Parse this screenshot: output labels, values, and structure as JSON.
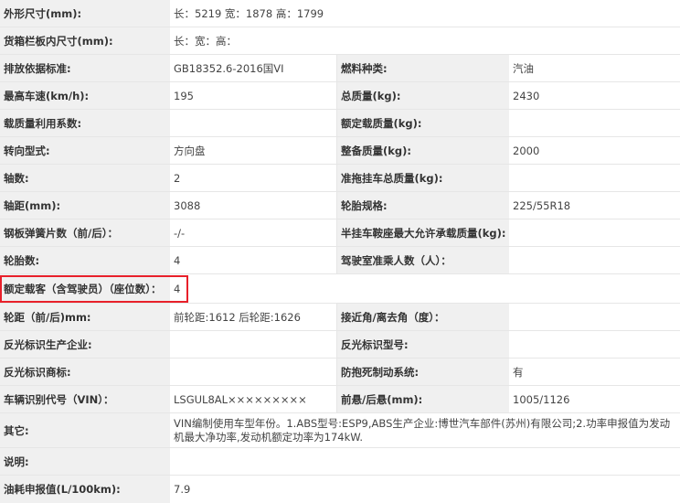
{
  "rows": [
    {
      "l1": "外形尺寸(mm):",
      "v1": "长：5219 宽：1878 高：1799"
    },
    {
      "l1": "货箱栏板内尺寸(mm):",
      "v1": "长：宽：高："
    },
    {
      "l1": "排放依据标准:",
      "v1": "GB18352.6-2016国VI",
      "l2": "燃料种类:",
      "v2": "汽油"
    },
    {
      "l1": "最高车速(km/h):",
      "v1": "195",
      "l2": "总质量(kg):",
      "v2": "2430"
    },
    {
      "l1": "载质量利用系数:",
      "v1": "",
      "l2": "额定载质量(kg):",
      "v2": ""
    },
    {
      "l1": "转向型式:",
      "v1": "方向盘",
      "l2": "整备质量(kg):",
      "v2": "2000"
    },
    {
      "l1": "轴数:",
      "v1": "2",
      "l2": "准拖挂车总质量(kg):",
      "v2": ""
    },
    {
      "l1": "轴距(mm):",
      "v1": "3088",
      "l2": "轮胎规格:",
      "v2": "225/55R18"
    },
    {
      "l1": "钢板弹簧片数（前/后）：",
      "v1": "-/-",
      "l2": "半挂车鞍座最大允许承载质量(kg):",
      "v2": ""
    },
    {
      "l1": "轮胎数:",
      "v1": "4",
      "l2": "驾驶室准乘人数（人）：",
      "v2": ""
    },
    {
      "l1": "额定载客（含驾驶员）（座位数）：",
      "v1": "4"
    },
    {
      "l1": "轮距（前/后)mm:",
      "v1": "前轮距:1612 后轮距:1626",
      "l2": "接近角/离去角（度）：",
      "v2": ""
    },
    {
      "l1": "反光标识生产企业:",
      "v1": "",
      "l2": "反光标识型号:",
      "v2": ""
    },
    {
      "l1": "反光标识商标:",
      "v1": "",
      "l2": "防抱死制动系统:",
      "v2": "有"
    },
    {
      "l1": "车辆识别代号（VIN）：",
      "v1": "LSGUL8AL×××××××××",
      "l2": "前悬/后悬(mm):",
      "v2": "1005/1126"
    },
    {
      "l1": "其它:",
      "v1": "VIN编制使用车型年份。1.ABS型号:ESP9,ABS生产企业:博世汽车部件(苏州)有限公司;2.功率申报值为发动机最大净功率,发动机额定功率为174kW."
    },
    {
      "l1": "说明:",
      "v1": ""
    },
    {
      "l1": "油耗申报值(L/100km):",
      "v1": "7.9"
    }
  ],
  "highlight_color": "#e8202a"
}
